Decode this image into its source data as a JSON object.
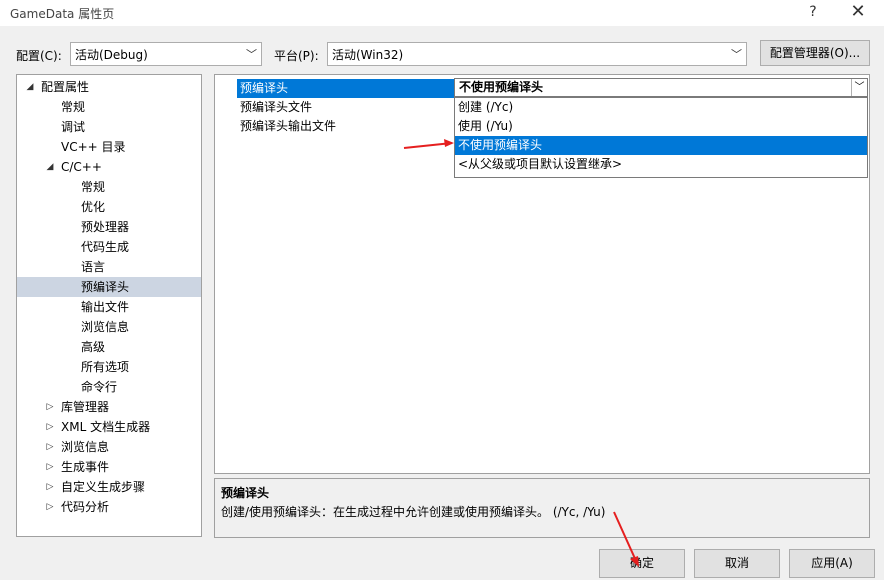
{
  "window": {
    "title": "GameData 属性页",
    "help_glyph": "?",
    "close_glyph": "✕"
  },
  "config_row": {
    "config_label": "配置(C):",
    "config_value": "活动(Debug)",
    "platform_label": "平台(P):",
    "platform_value": "活动(Win32)",
    "config_manager_button": "配置管理器(O)..."
  },
  "tree": {
    "items": [
      {
        "label": "配置属性",
        "expander": "◢"
      },
      {
        "label": "常规"
      },
      {
        "label": "调试"
      },
      {
        "label": "VC++ 目录"
      },
      {
        "label": "C/C++",
        "expander": "◢"
      },
      {
        "label": "常规"
      },
      {
        "label": "优化"
      },
      {
        "label": "预处理器"
      },
      {
        "label": "代码生成"
      },
      {
        "label": "语言"
      },
      {
        "label": "预编译头",
        "selected": true
      },
      {
        "label": "输出文件"
      },
      {
        "label": "浏览信息"
      },
      {
        "label": "高级"
      },
      {
        "label": "所有选项"
      },
      {
        "label": "命令行"
      },
      {
        "label": "库管理器",
        "expander": "▷"
      },
      {
        "label": "XML 文档生成器",
        "expander": "▷"
      },
      {
        "label": "浏览信息",
        "expander": "▷"
      },
      {
        "label": "生成事件",
        "expander": "▷"
      },
      {
        "label": "自定义生成步骤",
        "expander": "▷"
      },
      {
        "label": "代码分析",
        "expander": "▷"
      }
    ]
  },
  "properties": {
    "rows": [
      {
        "name": "预编译头"
      },
      {
        "name": "预编译头文件"
      },
      {
        "name": "预编译头输出文件"
      }
    ],
    "current_value": "不使用预编译头",
    "dropdown_options": [
      "创建 (/Yc)",
      "使用 (/Yu)",
      "不使用预编译头",
      "<从父级或项目默认设置继承>"
    ],
    "selected_option_index": 2
  },
  "description": {
    "title": "预编译头",
    "text": "创建/使用预编译头：在生成过程中允许创建或使用预编译头。     (/Yc, /Yu)"
  },
  "buttons": {
    "ok": "确定",
    "cancel": "取消",
    "apply": "应用(A)"
  },
  "colors": {
    "selection_blue": "#0078d7",
    "tree_selection": "#ccd5e2",
    "annotation_red": "#e51f1f"
  }
}
